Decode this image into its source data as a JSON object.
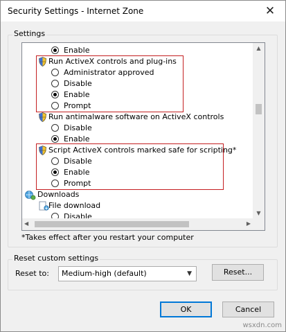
{
  "window": {
    "title": "Security Settings - Internet Zone",
    "close_glyph": "✕"
  },
  "settings_group": {
    "label": "Settings",
    "items": [
      {
        "type": "option",
        "label": "Enable",
        "checked": true
      },
      {
        "type": "header",
        "icon": "shield-icon",
        "label": "Run ActiveX controls and plug-ins"
      },
      {
        "type": "option",
        "label": "Administrator approved",
        "checked": false
      },
      {
        "type": "option",
        "label": "Disable",
        "checked": false
      },
      {
        "type": "option",
        "label": "Enable",
        "checked": true
      },
      {
        "type": "option",
        "label": "Prompt",
        "checked": false
      },
      {
        "type": "header",
        "icon": "shield-icon",
        "label": "Run antimalware software on ActiveX controls"
      },
      {
        "type": "option",
        "label": "Disable",
        "checked": false
      },
      {
        "type": "option",
        "label": "Enable",
        "checked": true
      },
      {
        "type": "header",
        "icon": "shield-icon",
        "label": "Script ActiveX controls marked safe for scripting*"
      },
      {
        "type": "option",
        "label": "Disable",
        "checked": false
      },
      {
        "type": "option",
        "label": "Enable",
        "checked": true
      },
      {
        "type": "option",
        "label": "Prompt",
        "checked": false
      },
      {
        "type": "category",
        "icon": "globe-gear-icon",
        "label": "Downloads"
      },
      {
        "type": "header",
        "icon": "file-download-icon",
        "label": "File download"
      },
      {
        "type": "option",
        "label": "Disable",
        "checked": false
      }
    ],
    "footnote": "*Takes effect after you restart your computer"
  },
  "reset_group": {
    "label": "Reset custom settings",
    "reset_to_label": "Reset to:",
    "selected_level": "Medium-high (default)",
    "reset_button": "Reset..."
  },
  "buttons": {
    "ok": "OK",
    "cancel": "Cancel"
  },
  "watermark": "wsxdn.com",
  "colors": {
    "highlight_border": "#c41e20",
    "default_button_border": "#0078d7"
  }
}
